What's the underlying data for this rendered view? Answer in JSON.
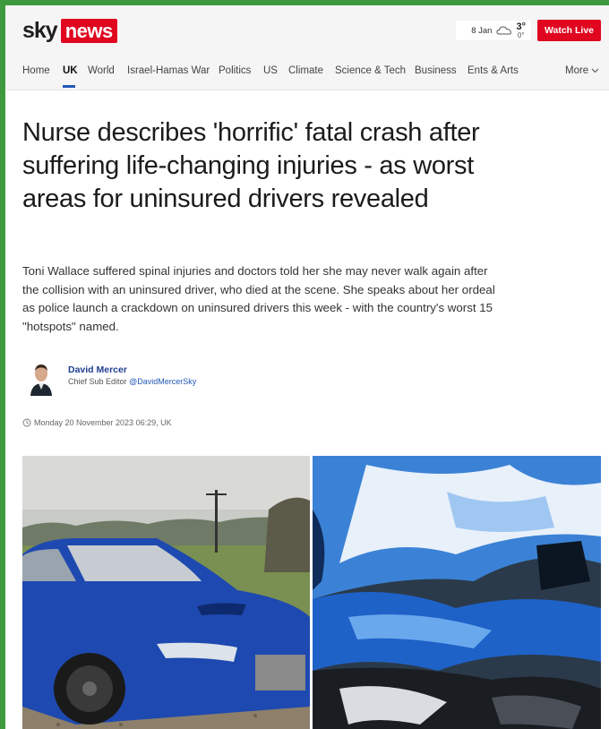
{
  "header": {
    "logo_sky": "sky",
    "logo_news": "news",
    "weather": {
      "date": "8 Jan",
      "temp_high": "3°",
      "temp_low": "0°",
      "icon": "cloud-icon"
    },
    "watch_live": "Watch Live"
  },
  "nav": {
    "items": [
      "Home",
      "UK",
      "World",
      "Israel-Hamas War",
      "Politics",
      "US",
      "Climate",
      "Science & Tech",
      "Business",
      "Ents & Arts"
    ],
    "active": "UK",
    "more": "More"
  },
  "article": {
    "headline": "Nurse describes 'horrific' fatal crash after suffering life-changing injuries - as worst areas for uninsured drivers revealed",
    "standfirst": "Toni Wallace suffered spinal injuries and doctors told her she may never walk again after the collision with an uninsured driver, who died at the scene. She speaks about her ordeal as police launch a crackdown on uninsured drivers this week - with the country's worst 15 \"hotspots\" named.",
    "author": {
      "name": "David Mercer",
      "role": "Chief Sub Editor",
      "handle": "@DavidMercerSky"
    },
    "timestamp": "Monday 20 November 2023 06:29, UK"
  },
  "colors": {
    "brand_red": "#e0061f",
    "link_blue": "#2359b8",
    "outer_green": "#3f9a3f"
  }
}
